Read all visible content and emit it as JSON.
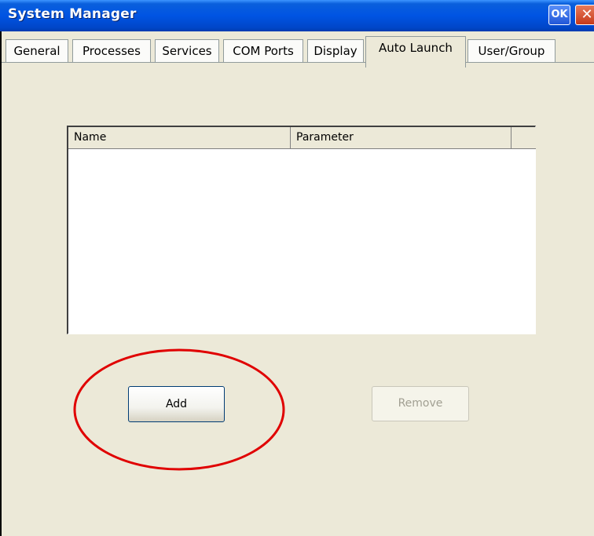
{
  "window": {
    "title": "System Manager",
    "ok_label": "OK",
    "close_label": "✕"
  },
  "tabs": [
    {
      "label": "General",
      "active": false
    },
    {
      "label": "Processes",
      "active": false
    },
    {
      "label": "Services",
      "active": false
    },
    {
      "label": "COM Ports",
      "active": false
    },
    {
      "label": "Display",
      "active": false
    },
    {
      "label": "Auto Launch",
      "active": true
    },
    {
      "label": "User/Group",
      "active": false
    }
  ],
  "list": {
    "columns": [
      "Name",
      "Parameter",
      ""
    ],
    "rows": []
  },
  "buttons": {
    "add_label": "Add",
    "remove_label": "Remove"
  },
  "colors": {
    "titlebar": "#0054e3",
    "highlight_annotation": "#e00000",
    "window_bg": "#ece9d8"
  },
  "icons": {
    "close": "close-icon"
  }
}
